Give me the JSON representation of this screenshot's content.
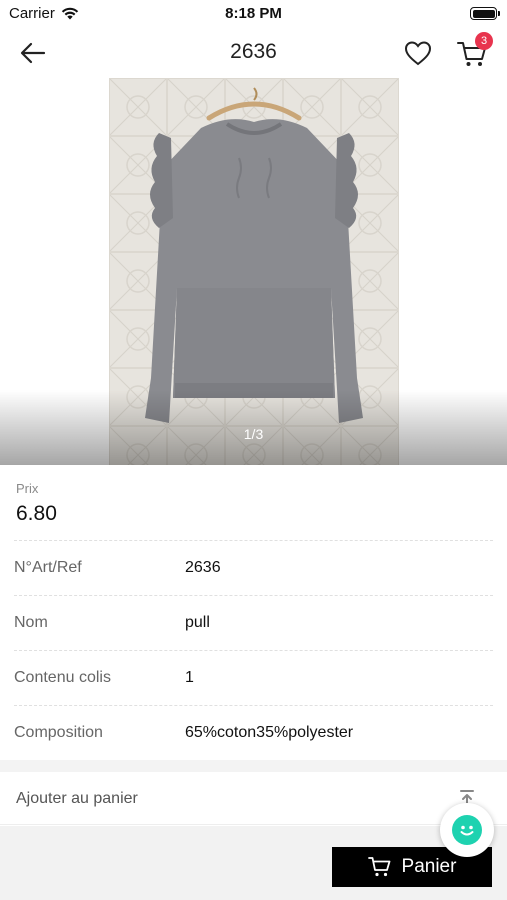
{
  "status_bar": {
    "carrier": "Carrier",
    "time": "8:18 PM"
  },
  "nav": {
    "title": "2636",
    "cart_count": "3"
  },
  "gallery": {
    "pager": "1/3"
  },
  "price": {
    "label": "Prix",
    "value": "6.80"
  },
  "details": [
    {
      "label": "N°Art/Ref",
      "value": "2636"
    },
    {
      "label": "Nom",
      "value": "pull"
    },
    {
      "label": "Contenu colis",
      "value": "1"
    },
    {
      "label": "Composition",
      "value": "65%coton35%polyester"
    }
  ],
  "add_to_cart": {
    "label": "Ajouter au panier"
  },
  "footer": {
    "cart_button": "Panier"
  },
  "colors": {
    "badge": "#e8344e",
    "chat": "#1ed2b0",
    "button": "#000000"
  }
}
